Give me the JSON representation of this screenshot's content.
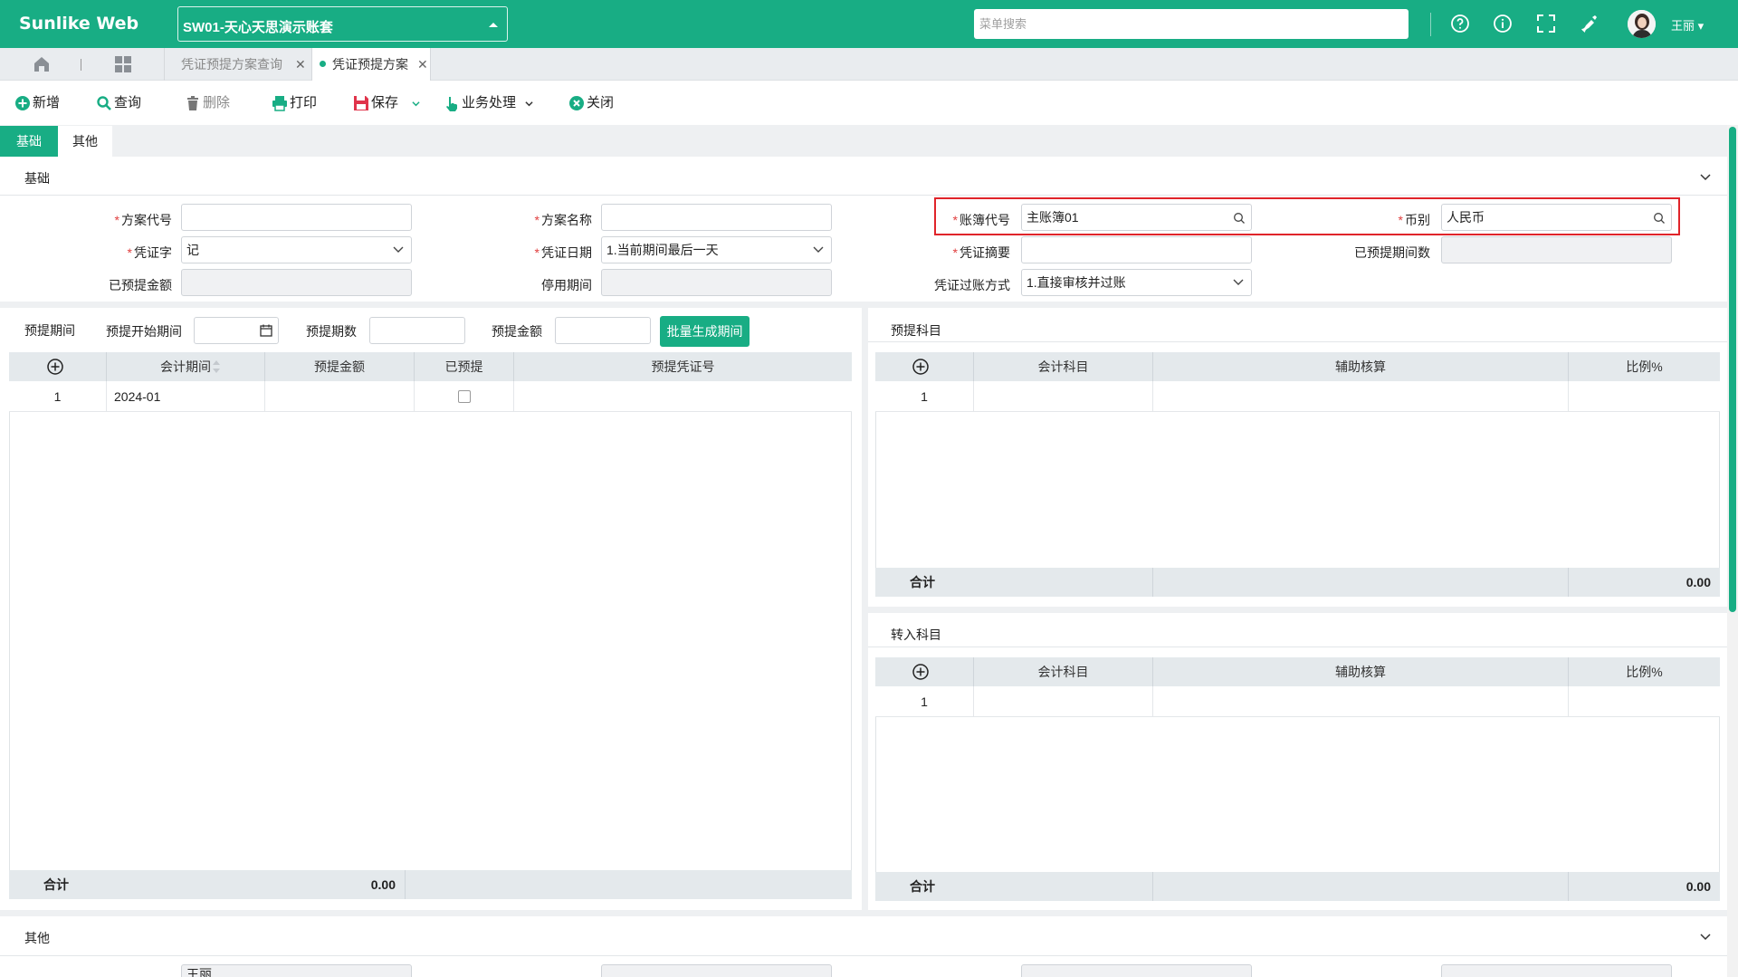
{
  "app": {
    "brand": "Sunlike Web",
    "account": "SW01-天心天思演示账套",
    "menu_search_placeholder": "菜单搜索",
    "user": "王丽"
  },
  "page_tabs": [
    {
      "label": "凭证预提方案查询",
      "active": false
    },
    {
      "label": "凭证预提方案",
      "active": true
    }
  ],
  "toolbar": {
    "add": "新增",
    "query": "查询",
    "delete": "删除",
    "print": "打印",
    "save": "保存",
    "business": "业务处理",
    "close": "关闭"
  },
  "form_tabs": [
    "基础",
    "其他"
  ],
  "basic_section": {
    "title": "基础",
    "fields": {
      "plan_code": {
        "label": "方案代号",
        "value": ""
      },
      "plan_name": {
        "label": "方案名称",
        "value": ""
      },
      "book_code": {
        "label": "账簿代号",
        "value": "主账簿01"
      },
      "currency": {
        "label": "币别",
        "value": "人民币"
      },
      "voucher_word": {
        "label": "凭证字",
        "value": "记"
      },
      "voucher_date": {
        "label": "凭证日期",
        "value": "1.当前期间最后一天"
      },
      "voucher_summary": {
        "label": "凭证摘要",
        "value": ""
      },
      "accrued_periods": {
        "label": "已预提期间数",
        "value": ""
      },
      "accrued_amount": {
        "label": "已预提金额",
        "value": ""
      },
      "disable_period": {
        "label": "停用期间",
        "value": ""
      },
      "posting_mode": {
        "label": "凭证过账方式",
        "value": "1.直接审核并过账"
      }
    }
  },
  "period_section": {
    "title": "预提期间",
    "start_label": "预提开始期间",
    "count_label": "预提期数",
    "amount_label": "预提金额",
    "batch_button": "批量生成期间",
    "columns": [
      "会计期间",
      "预提金额",
      "已预提",
      "预提凭证号"
    ],
    "rows": [
      {
        "no": "1",
        "period": "2024-01",
        "amount": "",
        "accrued": false,
        "voucher_no": ""
      }
    ],
    "sum_label": "合计",
    "sum_amount": "0.00"
  },
  "accrual_accounts": {
    "title": "预提科目",
    "columns": [
      "会计科目",
      "辅助核算",
      "比例%"
    ],
    "rows": [
      {
        "no": "1"
      }
    ],
    "sum_label": "合计",
    "sum_value": "0.00"
  },
  "transfer_accounts": {
    "title": "转入科目",
    "columns": [
      "会计科目",
      "辅助核算",
      "比例%"
    ],
    "rows": [
      {
        "no": "1"
      }
    ],
    "sum_label": "合计",
    "sum_value": "0.00"
  },
  "other_section": {
    "title": "其他",
    "first_value": "王丽"
  },
  "colors": {
    "brand": "#18ad84",
    "required": "#e03e3e",
    "highlight": "#e0242a"
  }
}
